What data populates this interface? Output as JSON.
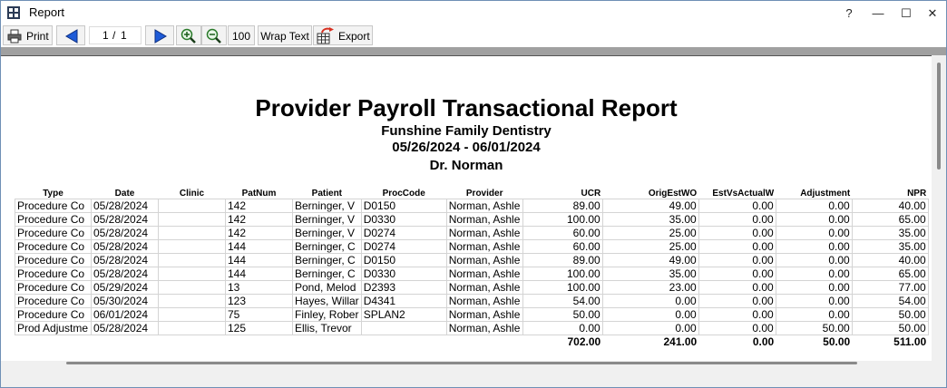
{
  "window": {
    "title": "Report",
    "help": "?",
    "minimize": "—",
    "maximize": "☐",
    "close": "✕"
  },
  "toolbar": {
    "print_label": "Print",
    "page_current": "1",
    "page_sep": "/",
    "page_total": "1",
    "zoom_level": "100",
    "wrap_text_label": "Wrap Text",
    "export_label": "Export"
  },
  "report": {
    "title": "Provider Payroll Transactional Report",
    "practice": "Funshine Family Dentistry",
    "date_range": "05/26/2024 - 06/01/2024",
    "provider": "Dr. Norman"
  },
  "table": {
    "headers": [
      "Type",
      "Date",
      "Clinic",
      "PatNum",
      "Patient",
      "ProcCode",
      "Provider",
      "UCR",
      "OrigEstWO",
      "EstVsActualW",
      "Adjustment",
      "NPR"
    ],
    "rows": [
      [
        "Procedure Co",
        "05/28/2024",
        "",
        "142",
        "Berninger, V",
        "D0150",
        "Norman, Ashle",
        "89.00",
        "49.00",
        "0.00",
        "0.00",
        "40.00"
      ],
      [
        "Procedure Co",
        "05/28/2024",
        "",
        "142",
        "Berninger, V",
        "D0330",
        "Norman, Ashle",
        "100.00",
        "35.00",
        "0.00",
        "0.00",
        "65.00"
      ],
      [
        "Procedure Co",
        "05/28/2024",
        "",
        "142",
        "Berninger, V",
        "D0274",
        "Norman, Ashle",
        "60.00",
        "25.00",
        "0.00",
        "0.00",
        "35.00"
      ],
      [
        "Procedure Co",
        "05/28/2024",
        "",
        "144",
        "Berninger, C",
        "D0274",
        "Norman, Ashle",
        "60.00",
        "25.00",
        "0.00",
        "0.00",
        "35.00"
      ],
      [
        "Procedure Co",
        "05/28/2024",
        "",
        "144",
        "Berninger, C",
        "D0150",
        "Norman, Ashle",
        "89.00",
        "49.00",
        "0.00",
        "0.00",
        "40.00"
      ],
      [
        "Procedure Co",
        "05/28/2024",
        "",
        "144",
        "Berninger, C",
        "D0330",
        "Norman, Ashle",
        "100.00",
        "35.00",
        "0.00",
        "0.00",
        "65.00"
      ],
      [
        "Procedure Co",
        "05/29/2024",
        "",
        "13",
        "Pond, Melod",
        "D2393",
        "Norman, Ashle",
        "100.00",
        "23.00",
        "0.00",
        "0.00",
        "77.00"
      ],
      [
        "Procedure Co",
        "05/30/2024",
        "",
        "123",
        "Hayes, Willar",
        "D4341",
        "Norman, Ashle",
        "54.00",
        "0.00",
        "0.00",
        "0.00",
        "54.00"
      ],
      [
        "Procedure Co",
        "06/01/2024",
        "",
        "75",
        "Finley, Rober",
        "SPLAN2",
        "Norman, Ashle",
        "50.00",
        "0.00",
        "0.00",
        "0.00",
        "50.00"
      ],
      [
        "Prod Adjustme",
        "05/28/2024",
        "",
        "125",
        "Ellis, Trevor",
        "",
        "Norman, Ashle",
        "0.00",
        "0.00",
        "0.00",
        "50.00",
        "50.00"
      ]
    ],
    "totals": [
      "702.00",
      "241.00",
      "0.00",
      "50.00",
      "511.00"
    ]
  },
  "colors": {
    "window_border": "#6f8fb5",
    "nav_arrow": "#1e5bd8",
    "export_arrow": "#d83020",
    "zoom_icon": "#2a7a2a"
  },
  "icons": [
    "app-grid-icon",
    "printer-icon",
    "prev-arrow-icon",
    "next-arrow-icon",
    "zoom-in-icon",
    "zoom-out-icon",
    "export-table-icon"
  ]
}
